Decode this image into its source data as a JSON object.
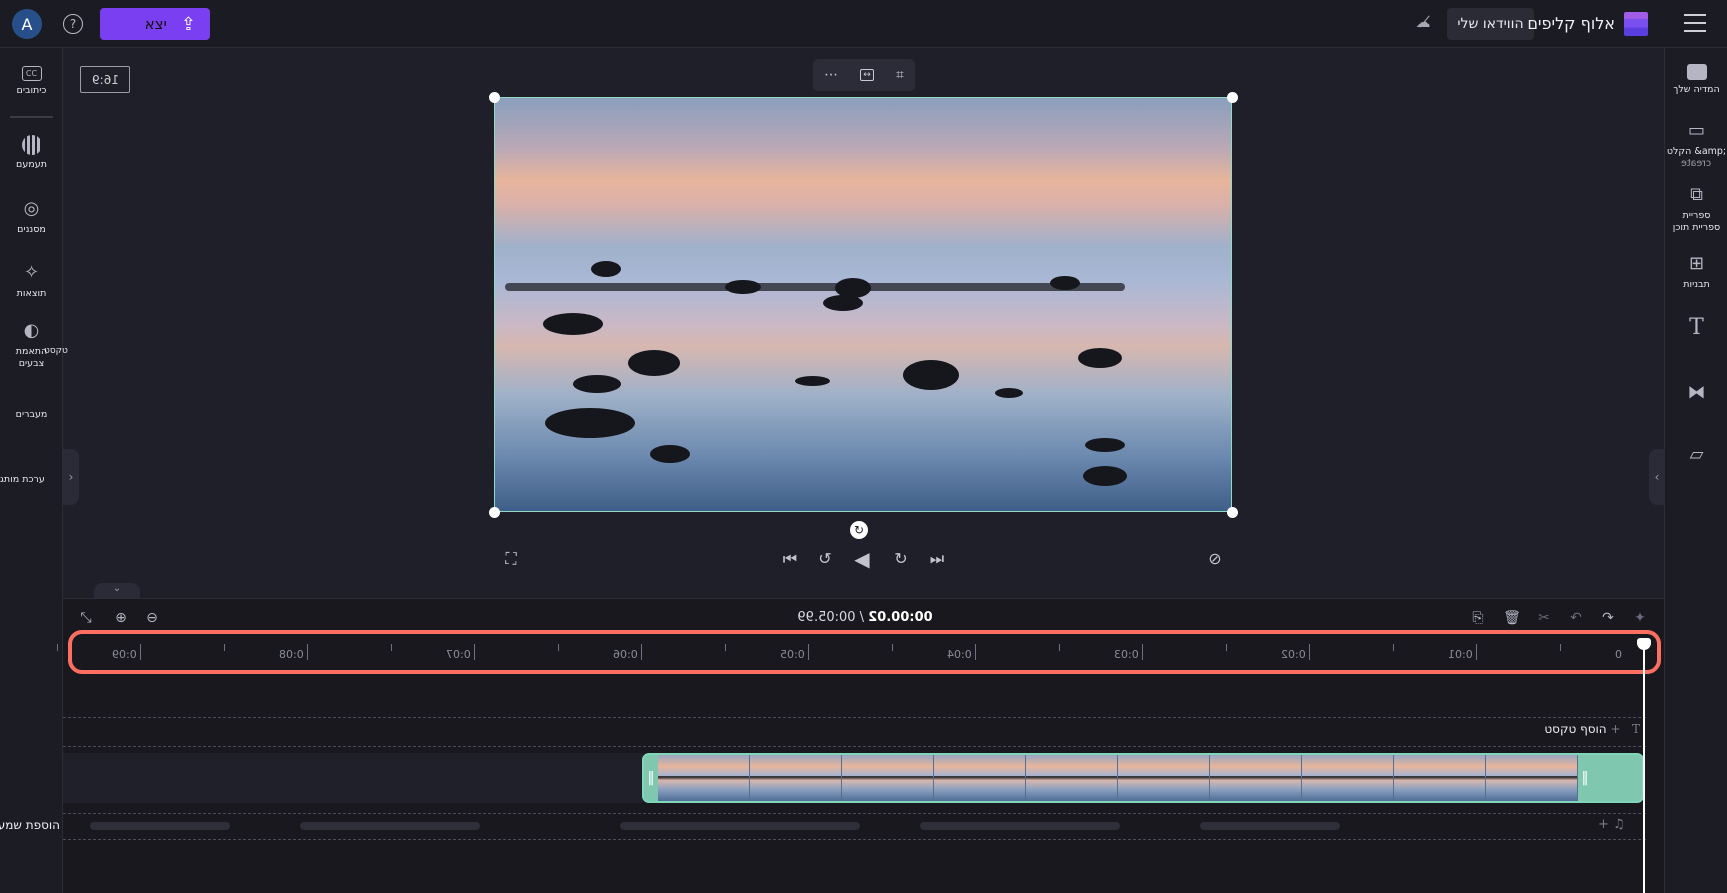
{
  "topbar": {
    "avatar_letter": "A",
    "help_icon": "question-icon",
    "export_label": "יצא",
    "export_icon": "upload-icon",
    "brand": "אלוף קליפים",
    "my_videos": "הווידאו שלי",
    "menu_icon": "hamburger-icon",
    "accent": "#7b3ff2"
  },
  "left_sidebar": {
    "items": [
      {
        "label": "כיתובים",
        "icon": "captions-icon"
      },
      {
        "label": "תעמעם",
        "icon": "fade-icon"
      },
      {
        "label": "מסננים",
        "icon": "filters-icon"
      },
      {
        "label": "תוצאות",
        "icon": "effects-icon"
      },
      {
        "label": "התאמת צבעים",
        "icon": "color-adjust-icon"
      },
      {
        "label": "מעברים",
        "icon": "transitions-icon"
      },
      {
        "label": "ערכת מותג",
        "icon": "brand-kit-icon"
      }
    ],
    "stray_label": "טקסט"
  },
  "right_sidebar": {
    "items": [
      {
        "label": "המדיה שלך",
        "icon": "folder-icon"
      },
      {
        "label": "הקלט &amp;",
        "sublabel": "create",
        "icon": "camera-icon"
      },
      {
        "label": "ספריית ספריית תוכן",
        "icon": "content-library-icon"
      },
      {
        "label": "תבניות",
        "icon": "templates-icon"
      },
      {
        "label": "",
        "icon": "text-icon"
      },
      {
        "label": "",
        "icon": "transitions-icon"
      },
      {
        "label": "",
        "icon": "stickers-icon"
      }
    ]
  },
  "preview": {
    "aspect_ratio": "16:9",
    "toolbar": [
      "more-icon",
      "fit-icon",
      "crop-icon"
    ]
  },
  "playback": {
    "controls": [
      "fullscreen-icon",
      "skip-back-icon",
      "rewind-5-icon",
      "play-icon",
      "forward-5-icon",
      "skip-forward-icon",
      "captions-off-icon"
    ]
  },
  "timeline": {
    "current_time": "00:00.02",
    "separator": " / ",
    "total_time": "00:05.99",
    "ruler_labels": [
      "0",
      "0:01",
      "0:02",
      "0:03",
      "0:04",
      "0:05",
      "0:06",
      "0:07",
      "0:08",
      "0:09"
    ],
    "add_text": "הוסף טקסט",
    "add_audio": "הוספת שמע",
    "highlight_color": "#ff6f61",
    "clip_border_color": "#7fd6b8"
  }
}
